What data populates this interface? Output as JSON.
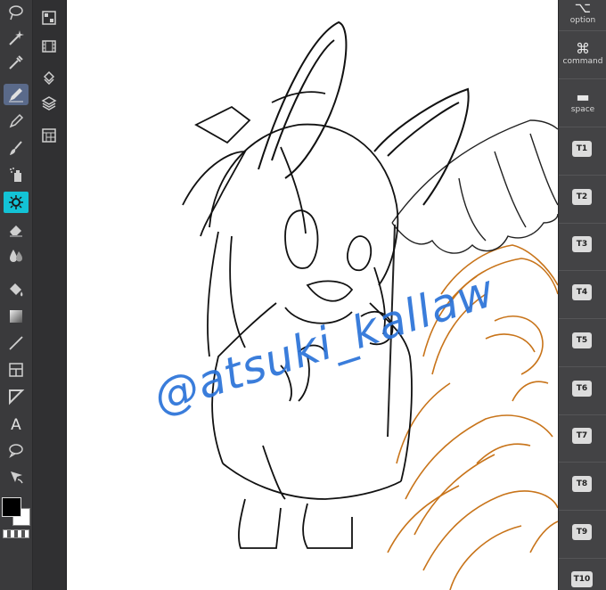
{
  "left_toolbar": {
    "tools": [
      {
        "icon": "lasso-icon",
        "name": "lasso"
      },
      {
        "icon": "magic-wand-icon",
        "name": "magic-wand"
      },
      {
        "icon": "eyedropper-icon",
        "name": "eyedropper"
      },
      {
        "icon": "pen-icon",
        "name": "pen",
        "active": true
      },
      {
        "icon": "pencil-icon",
        "name": "pencil"
      },
      {
        "icon": "brush-icon",
        "name": "brush"
      },
      {
        "icon": "airbrush-icon",
        "name": "airbrush"
      },
      {
        "icon": "decoration-icon",
        "name": "decoration"
      },
      {
        "icon": "eraser-icon",
        "name": "eraser"
      },
      {
        "icon": "blend-icon",
        "name": "blend"
      },
      {
        "icon": "fill-icon",
        "name": "fill"
      },
      {
        "icon": "gradient-icon",
        "name": "gradient"
      },
      {
        "icon": "line-icon",
        "name": "figure"
      },
      {
        "icon": "frame-icon",
        "name": "frame-border"
      },
      {
        "icon": "ruler-icon",
        "name": "ruler"
      },
      {
        "icon": "text-icon",
        "name": "text"
      },
      {
        "icon": "balloon-icon",
        "name": "balloon"
      },
      {
        "icon": "correct-line-icon",
        "name": "correct-line"
      }
    ],
    "main_color": "#000000",
    "sub_color": "#ffffff"
  },
  "sub_toolbar": {
    "items": [
      {
        "icon": "tool-property-icon"
      },
      {
        "icon": "color-set-icon"
      },
      {
        "icon": "animation-icon"
      },
      {
        "icon": "layer-property-icon"
      },
      {
        "icon": "layers-icon"
      },
      {
        "icon": "material-icon"
      }
    ]
  },
  "canvas": {
    "watermark": "@atsuki_kallaw",
    "watermark_color": "#2a72d8",
    "sketch_color": "#c8741a"
  },
  "right_panel": {
    "modifiers": [
      {
        "glyph": "⌥",
        "label": "option"
      },
      {
        "glyph": "⌘",
        "label": "command"
      },
      {
        "glyph": "▬",
        "label": "space"
      }
    ],
    "tbuttons": [
      "T1",
      "T2",
      "T3",
      "T4",
      "T5",
      "T6",
      "T7",
      "T8",
      "T9",
      "T10"
    ]
  }
}
